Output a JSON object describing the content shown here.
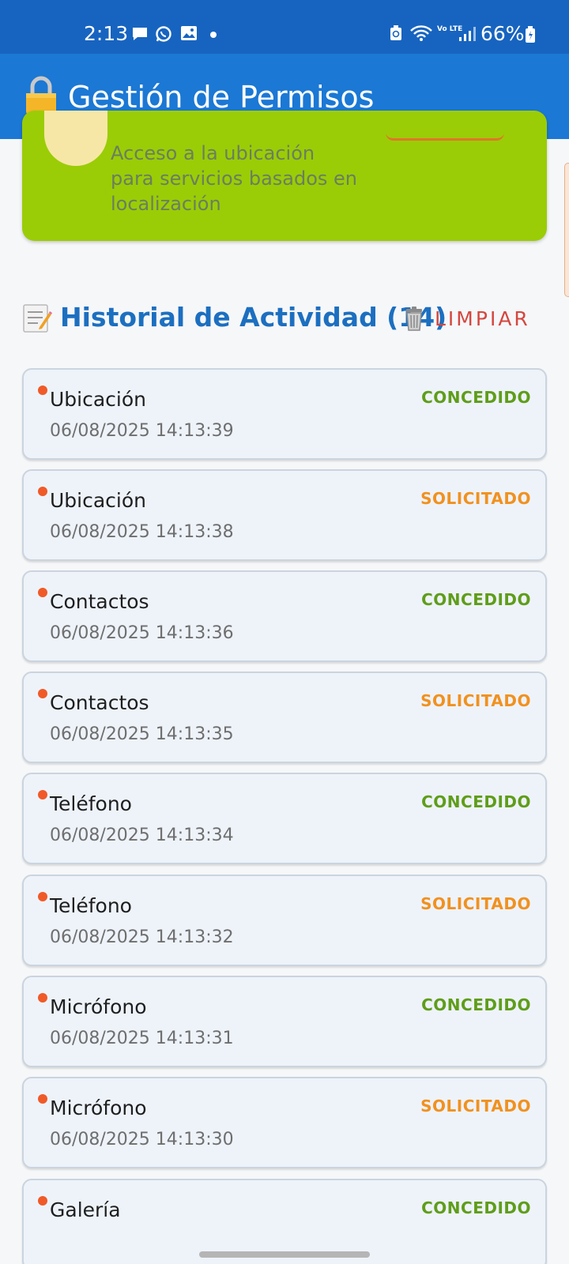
{
  "status_bar": {
    "time": "2:13",
    "volte": "Vo LTE",
    "battery": "66%"
  },
  "app_bar": {
    "title": "Gestión de Permisos",
    "icon": "lock-icon"
  },
  "location_card": {
    "description": "Acceso a la ubicación para servicios basados en localización",
    "background": "#9acd06"
  },
  "history": {
    "title": "Historial de Actividad (14)",
    "clear_label": "LIMPIAR",
    "items": [
      {
        "name": "Ubicación",
        "timestamp": "06/08/2025 14:13:39",
        "status": "CONCEDIDO",
        "kind": "granted"
      },
      {
        "name": "Ubicación",
        "timestamp": "06/08/2025 14:13:38",
        "status": "SOLICITADO",
        "kind": "requested"
      },
      {
        "name": "Contactos",
        "timestamp": "06/08/2025 14:13:36",
        "status": "CONCEDIDO",
        "kind": "granted"
      },
      {
        "name": "Contactos",
        "timestamp": "06/08/2025 14:13:35",
        "status": "SOLICITADO",
        "kind": "requested"
      },
      {
        "name": "Teléfono",
        "timestamp": "06/08/2025 14:13:34",
        "status": "CONCEDIDO",
        "kind": "granted"
      },
      {
        "name": "Teléfono",
        "timestamp": "06/08/2025 14:13:32",
        "status": "SOLICITADO",
        "kind": "requested"
      },
      {
        "name": "Micrófono",
        "timestamp": "06/08/2025 14:13:31",
        "status": "CONCEDIDO",
        "kind": "granted"
      },
      {
        "name": "Micrófono",
        "timestamp": "06/08/2025 14:13:30",
        "status": "SOLICITADO",
        "kind": "requested"
      },
      {
        "name": "Galería",
        "timestamp": "",
        "status": "CONCEDIDO",
        "kind": "granted"
      }
    ]
  },
  "colors": {
    "status_bar": "#1764c0",
    "app_bar": "#1b78d4",
    "history_title": "#1c6fc0",
    "clear": "#d4473f",
    "granted": "#5f9d1a",
    "requested": "#f1911f",
    "indicator": "#f05a28"
  }
}
